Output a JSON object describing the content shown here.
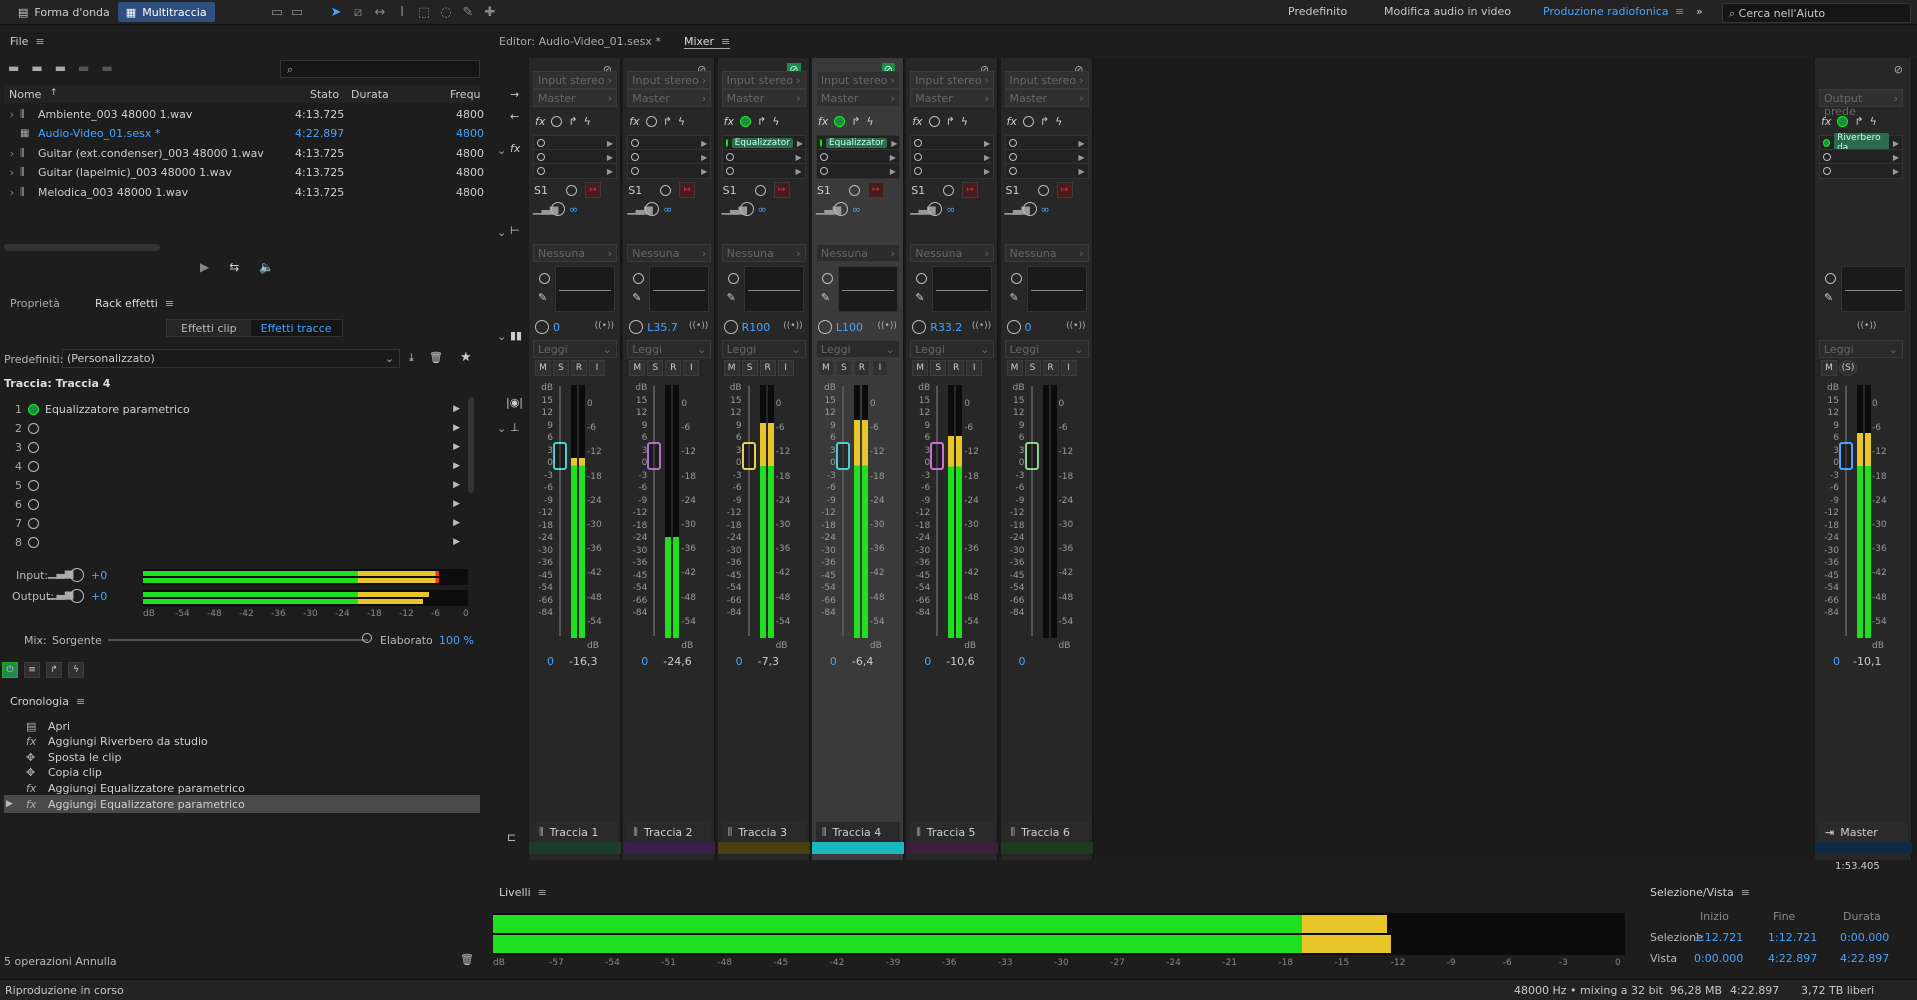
{
  "topbar": {
    "mode_waveform": "Forma d'onda",
    "mode_multitrack": "Multitraccia",
    "workspaces": [
      "Predefinito",
      "Modifica audio in video",
      "Produzione radiofonica"
    ],
    "search_placeholder": "Cerca nell'Aiuto"
  },
  "files": {
    "title": "File",
    "search_placeholder": "",
    "columns": [
      "Nome",
      "Stato",
      "Durata",
      "Frequ"
    ],
    "rows": [
      {
        "name": "Ambiente_003 48000 1.wav",
        "duration": "4:13.725",
        "freq": "4800"
      },
      {
        "name": "Audio-Video_01.sesx *",
        "duration": "4:22.897",
        "freq": "4800"
      },
      {
        "name": "Guitar (ext.condenser)_003 48000 1.wav",
        "duration": "4:13.725",
        "freq": "4800"
      },
      {
        "name": "Guitar (lapelmic)_003 48000 1.wav",
        "duration": "4:13.725",
        "freq": "4800"
      },
      {
        "name": "Melodica_003 48000 1.wav",
        "duration": "4:13.725",
        "freq": "4800"
      }
    ]
  },
  "rack": {
    "tab_properties": "Proprietà",
    "tab_rack": "Rack effetti",
    "sub_clip": "Effetti clip",
    "sub_track": "Effetti tracce",
    "presets_label": "Predefiniti:",
    "presets_value": "(Personalizzato)",
    "track_label": "Traccia: Traccia 4",
    "slots": [
      "Equalizzatore parametrico",
      "",
      "",
      "",
      "",
      "",
      "",
      ""
    ],
    "input_label": "Input:",
    "output_label": "Output:",
    "input_gain": "+0",
    "output_gain": "+0",
    "input_level": 0.91,
    "output_level": 0.88,
    "scale": [
      "dB",
      "-54",
      "-48",
      "-42",
      "-36",
      "-30",
      "-24",
      "-18",
      "-12",
      "-6",
      "0"
    ],
    "mix_label": "Mix:",
    "mix_source": "Sorgente",
    "mix_processed": "Elaborato",
    "mix_value": "100 %"
  },
  "history": {
    "title": "Cronologia",
    "items": [
      "Apri",
      "Aggiungi Riverbero da studio",
      "Sposta le clip",
      "Copia clip",
      "Aggiungi Equalizzatore parametrico",
      "Aggiungi Equalizzatore parametrico"
    ],
    "footer": "5 operazioni Annulla"
  },
  "editor": {
    "tab_editor": "Editor: Audio-Video_01.sesx *",
    "tab_mixer": "Mixer"
  },
  "mixer": {
    "input_label": "Input stereo",
    "output_label": "Master",
    "send_none": "Nessuna",
    "send_label": "S1",
    "read_label": "Leggi",
    "scale_left": [
      "dB",
      "15",
      "12",
      "9",
      "6",
      "3",
      "0",
      "-3",
      "-6",
      "-9",
      "-12",
      "-18",
      "-24",
      "-30",
      "-36",
      "-45",
      "-54",
      "-66",
      "-84"
    ],
    "scale_right": [
      "0",
      "-6",
      "-12",
      "-18",
      "-24",
      "-30",
      "-36",
      "-42",
      "-48",
      "-54",
      "dB"
    ],
    "tracks": [
      {
        "name": "Traccia 1",
        "pan": "0",
        "vol": "0",
        "peak": "-16,3",
        "color": "#1a3d2a",
        "knob": "#4ad0d0",
        "level": 0.71,
        "eq": false
      },
      {
        "name": "Traccia 2",
        "pan": "L35.7",
        "vol": "0",
        "peak": "-24,6",
        "color": "#3a1f4a",
        "knob": "#b070d0",
        "level": 0.4,
        "eq": false
      },
      {
        "name": "Traccia 3",
        "pan": "R100",
        "vol": "0",
        "peak": "-7,3",
        "color": "#4a3f10",
        "knob": "#e8d060",
        "level": 0.85,
        "eq": true
      },
      {
        "name": "Traccia 4",
        "pan": "L100",
        "vol": "0",
        "peak": "-6,4",
        "color": "#18b8c0",
        "knob": "#4ad0d0",
        "level": 0.86,
        "eq": true
      },
      {
        "name": "Traccia 5",
        "pan": "R33.2",
        "vol": "0",
        "peak": "-10,6",
        "color": "#3a1f3a",
        "knob": "#d070d0",
        "level": 0.8,
        "eq": false
      },
      {
        "name": "Traccia 6",
        "pan": "0",
        "vol": "0",
        "peak": "",
        "color": "#1f3a1f",
        "knob": "#90d090",
        "level": 0.0,
        "eq": false
      }
    ],
    "master": {
      "name": "Master",
      "out_label": "Output prede",
      "fx": "Riverbero da",
      "vol": "0",
      "peak": "-10,1",
      "level": 0.81,
      "time": "1:53.405"
    }
  },
  "levels": {
    "title": "Livelli",
    "level": 0.79,
    "scale": [
      "dB",
      "-57",
      "-54",
      "-51",
      "-48",
      "-45",
      "-42",
      "-39",
      "-36",
      "-33",
      "-30",
      "-27",
      "-24",
      "-21",
      "-18",
      "-15",
      "-12",
      "-9",
      "-6",
      "-3",
      "0"
    ]
  },
  "selection": {
    "title": "Selezione/Vista",
    "headers": [
      "Inizio",
      "Fine",
      "Durata"
    ],
    "row_sel": {
      "label": "Selezione",
      "start": "1:12.721",
      "end": "1:12.721",
      "dur": "0:00.000"
    },
    "row_view": {
      "label": "Vista",
      "start": "0:00.000",
      "end": "4:22.897",
      "dur": "4:22.897"
    }
  },
  "status": {
    "left": "Riproduzione in corso",
    "sample": "48000 Hz • mixing a 32 bit",
    "mem": "96,28 MB",
    "dur": "4:22.897",
    "free": "3,72 TB liberi"
  }
}
